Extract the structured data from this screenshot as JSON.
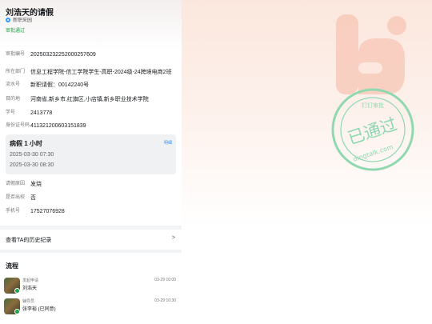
{
  "header": {
    "title": "刘浩天的请假",
    "source": "新职采园",
    "status": "审批通过"
  },
  "fields": [
    {
      "label": "审批编号",
      "value": "202503232252000257609"
    },
    {
      "label": "所在部门",
      "value": "信息工程学院-信工学院学生-高职-2024级-24跨境电商2班"
    },
    {
      "label": "流水号",
      "value": "新职请假：00142240号"
    },
    {
      "label": "目的地",
      "value": "河南省,新乡市,红旗区,小店镇,新乡职业技术学院"
    },
    {
      "label": "学号",
      "value": "2413778"
    },
    {
      "label": "身份证号码",
      "value": "411321200603151839"
    }
  ],
  "leave": {
    "title": "病假 1 小时",
    "link": "明细",
    "start": "2025-03-30 07:30",
    "end": "2025-03-30 08:30"
  },
  "extra": [
    {
      "label": "请假原因",
      "value": "发烧"
    },
    {
      "label": "是否出校",
      "value": "否"
    },
    {
      "label": "手机号",
      "value": "17527076928"
    }
  ],
  "history": {
    "label": "查看TA的历史纪录",
    "chevron": ">"
  },
  "flow": {
    "title": "流程",
    "steps": [
      {
        "action": "发起申请",
        "person": "刘浩天",
        "time": "03-29 10:00"
      },
      {
        "action": "辅导员",
        "person": "张李裕 (已同意)",
        "time": "03-29 10:30"
      }
    ]
  },
  "stamp": {
    "top": "钉钉审批",
    "main": "已通过",
    "bottom": "dingtalk.com"
  },
  "colors": {
    "accent_green": "#1fa348",
    "link_blue": "#3296fa",
    "logo_pink": "#f7c5b4"
  }
}
